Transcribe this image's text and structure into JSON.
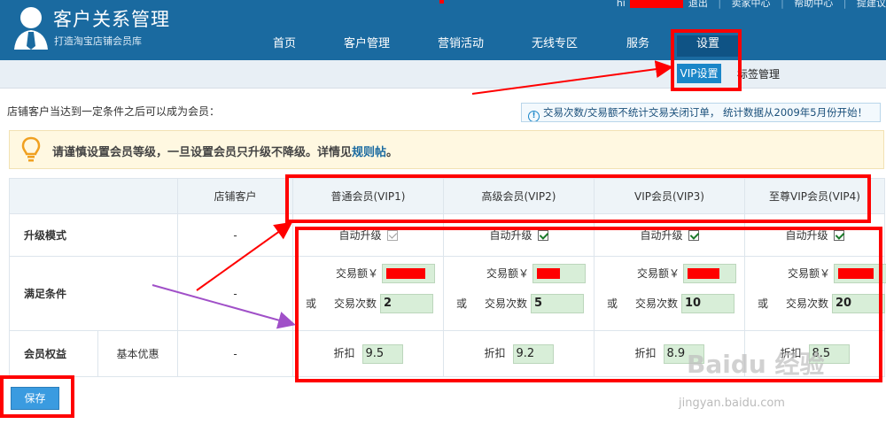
{
  "app": {
    "title": "客户关系管理",
    "subtitle": "打造淘宝店铺会员库"
  },
  "top_links": {
    "greeting": "hi",
    "logout": "退出",
    "seller_center": "卖家中心",
    "help_center": "帮助中心",
    "extra": "提建议"
  },
  "nav": {
    "items": [
      {
        "label": "首页"
      },
      {
        "label": "客户管理"
      },
      {
        "label": "营销活动"
      },
      {
        "label": "无线专区"
      },
      {
        "label": "服务"
      },
      {
        "label": "设置"
      }
    ],
    "active": "设置"
  },
  "subnav": {
    "vip": "VIP设置",
    "tags": "标签管理"
  },
  "intro": "店铺客户当达到一定条件之后可以成为会员：",
  "notice": "交易次数/交易额不统计交易关闭订单， 统计数据从2009年5月份开始！",
  "warning": {
    "text": "请谨慎设置会员等级，一旦设置会员只升级不降级。详情见",
    "link": "规则帖",
    "end": "。"
  },
  "table": {
    "header": {
      "store_customer": "店铺客户",
      "vip1": "普通会员(VIP1)",
      "vip2": "高级会员(VIP2)",
      "vip3": "VIP会员(VIP3)",
      "vip4": "至尊VIP会员(VIP4)"
    },
    "rows": {
      "upgrade_mode": "升级模式",
      "conditions": "满足条件",
      "benefits": "会员权益",
      "benefits_sub": "基本优惠"
    },
    "dash": "-",
    "auto_upgrade": "自动升级",
    "amount_label": "交易额￥",
    "or_label": "或",
    "count_label": "交易次数",
    "discount_label": "折扣",
    "levels": [
      {
        "checked": true,
        "disabled": true,
        "count": "2",
        "discount": "9.5"
      },
      {
        "checked": true,
        "disabled": false,
        "count": "5",
        "discount": "9.2"
      },
      {
        "checked": true,
        "disabled": false,
        "count": "10",
        "discount": "8.9"
      },
      {
        "checked": true,
        "disabled": false,
        "count": "20",
        "discount": "8.5"
      }
    ]
  },
  "save_button": "保存",
  "watermark": {
    "brand": "Baidu 经验",
    "url": "jingyan.baidu.com"
  },
  "colors": {
    "header_bg": "#1a6aa0",
    "accent": "#1a86c8",
    "annotation_red": "#ff0000",
    "annotation_purple": "#a050c8"
  }
}
